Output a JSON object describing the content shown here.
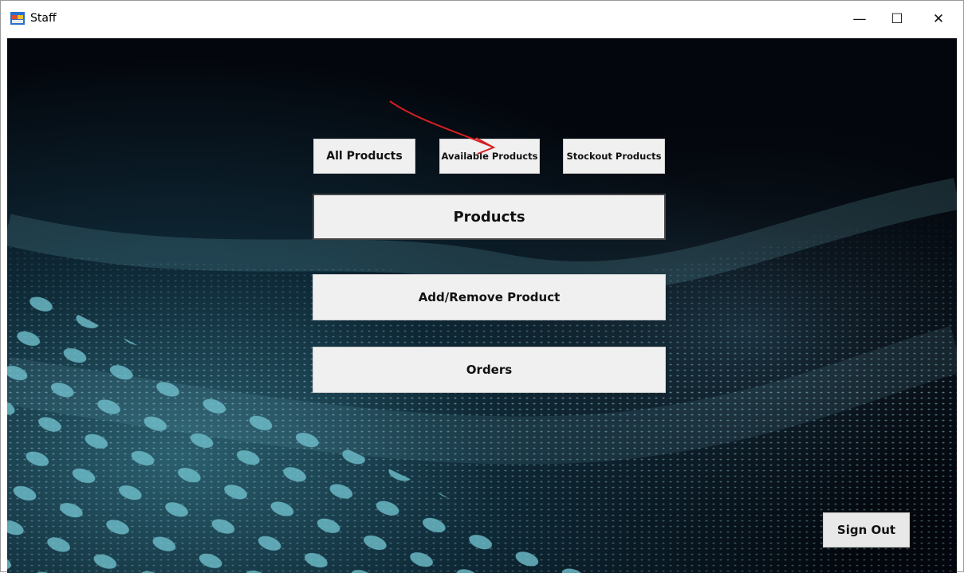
{
  "window": {
    "title": "Staff",
    "controls": {
      "minimize": "—",
      "maximize": "☐",
      "close": "✕"
    }
  },
  "buttons": {
    "all_products": "All Products",
    "available_products": "Available Products",
    "stockout_products": "Stockout Products",
    "products": "Products",
    "add_remove_product": "Add/Remove Product",
    "orders": "Orders",
    "sign_out": "Sign Out"
  },
  "colors": {
    "button_face": "#f0f0f0",
    "background_dark": "#05080f",
    "background_wave": "#5fa9b6",
    "annotation_arrow": "#d42020"
  }
}
